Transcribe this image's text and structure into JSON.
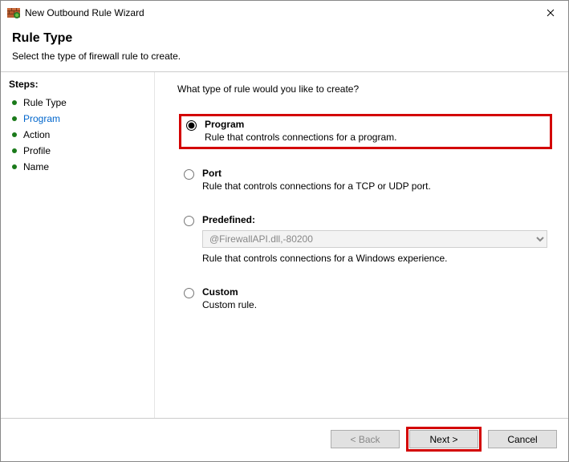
{
  "window": {
    "title": "New Outbound Rule Wizard"
  },
  "header": {
    "title": "Rule Type",
    "subtitle": "Select the type of firewall rule to create."
  },
  "sidebar": {
    "title": "Steps:",
    "items": [
      {
        "label": "Rule Type"
      },
      {
        "label": "Program"
      },
      {
        "label": "Action"
      },
      {
        "label": "Profile"
      },
      {
        "label": "Name"
      }
    ]
  },
  "main": {
    "question": "What type of rule would you like to create?",
    "options": {
      "program": {
        "title": "Program",
        "desc": "Rule that controls connections for a program."
      },
      "port": {
        "title": "Port",
        "desc": "Rule that controls connections for a TCP or UDP port."
      },
      "predefined": {
        "title": "Predefined:",
        "value": "@FirewallAPI.dll,-80200",
        "desc": "Rule that controls connections for a Windows experience."
      },
      "custom": {
        "title": "Custom",
        "desc": "Custom rule."
      }
    }
  },
  "footer": {
    "back": "< Back",
    "next": "Next >",
    "cancel": "Cancel"
  }
}
